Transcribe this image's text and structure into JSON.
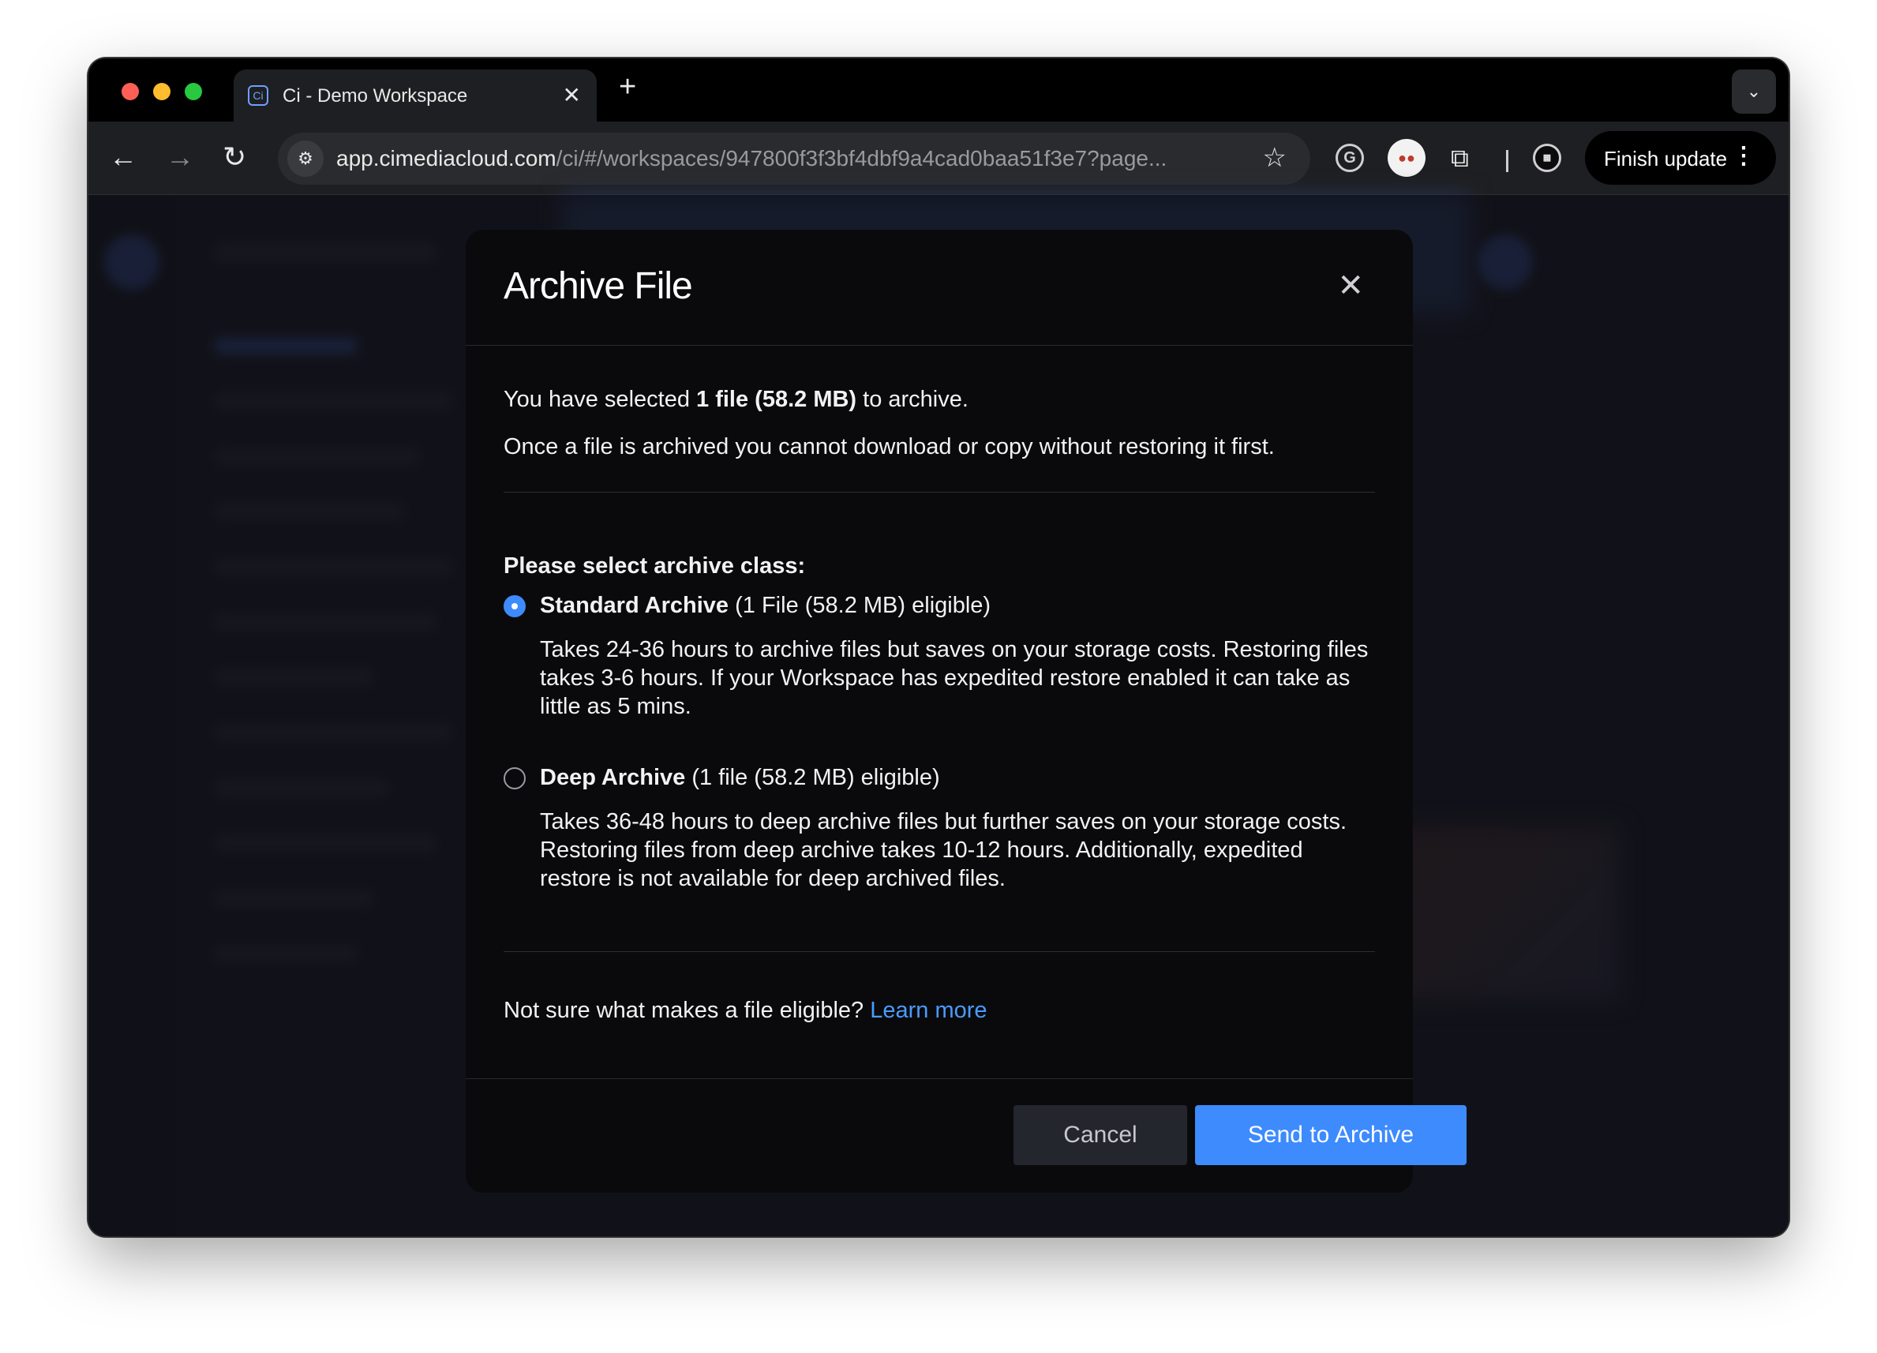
{
  "browser": {
    "tab_title": "Ci - Demo Workspace",
    "tab_favicon": "Ci",
    "new_tab": "+",
    "close_tab": "✕",
    "url_host": "app.cimediacloud.com",
    "url_path": "/ci/#/workspaces/947800f3f3bf4dbf9a4cad0baa51f3e7?page...",
    "finish_update_label": "Finish update",
    "icons": [
      "back-arrow-icon",
      "forward-arrow-icon",
      "reload-icon",
      "site-info-icon",
      "bookmark-star-icon",
      "grammarly-icon",
      "profile-avatar-icon",
      "extensions-puzzle-icon",
      "extension-icon",
      "more-vert-icon",
      "tab-search-icon"
    ]
  },
  "modal": {
    "title": "Archive File",
    "close": "✕",
    "selected_prefix": "You have selected ",
    "selected_bold": "1 file (58.2 MB)",
    "selected_suffix": " to archive.",
    "warning": "Once a file is archived you cannot download or copy without restoring it first.",
    "section_title": "Please select archive class:",
    "options": [
      {
        "name": "Standard Archive",
        "eligibility": " (1 File (58.2 MB) eligible)",
        "description": "Takes 24-36 hours to archive files but saves on your storage costs. Restoring files takes 3-6 hours. If your Workspace has expedited restore enabled it can take as little as 5 mins.",
        "selected": true
      },
      {
        "name": "Deep Archive",
        "eligibility": " (1 file (58.2 MB) eligible)",
        "description": "Takes 36-48 hours to deep archive files but further saves on your storage costs. Restoring files from deep archive takes 10-12 hours. Additionally, expedited restore is not available for deep archived files.",
        "selected": false
      }
    ],
    "eligible_question": "Not sure what makes a file eligible? ",
    "learn_more": "Learn more",
    "cancel_label": "Cancel",
    "send_label": "Send to Archive"
  },
  "colors": {
    "accent": "#3d8bfd",
    "link": "#4a9bff",
    "modal_bg": "#0a0a0c"
  }
}
